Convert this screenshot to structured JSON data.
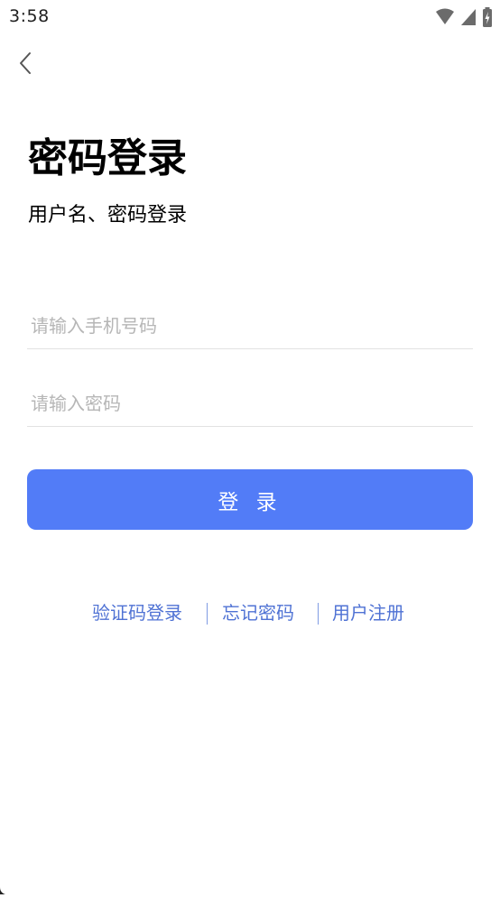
{
  "status_bar": {
    "time": "3:58",
    "icons": [
      "wifi-icon",
      "cellular-signal-icon",
      "battery-charging-icon"
    ]
  },
  "nav": {
    "back_icon": "chevron-left-icon"
  },
  "header": {
    "title": "密码登录",
    "subtitle": "用户名、密码登录"
  },
  "form": {
    "phone": {
      "value": "",
      "placeholder": "请输入手机号码"
    },
    "password": {
      "value": "",
      "placeholder": "请输入密码"
    },
    "submit_label": "登 录"
  },
  "links": {
    "sms_login": "验证码登录",
    "forgot_password": "忘记密码",
    "register": "用户注册"
  },
  "colors": {
    "primary_button": "#527cf7",
    "link": "#4f72d4",
    "input_underline": "#e2e2e2",
    "placeholder": "#b6b6b6"
  }
}
